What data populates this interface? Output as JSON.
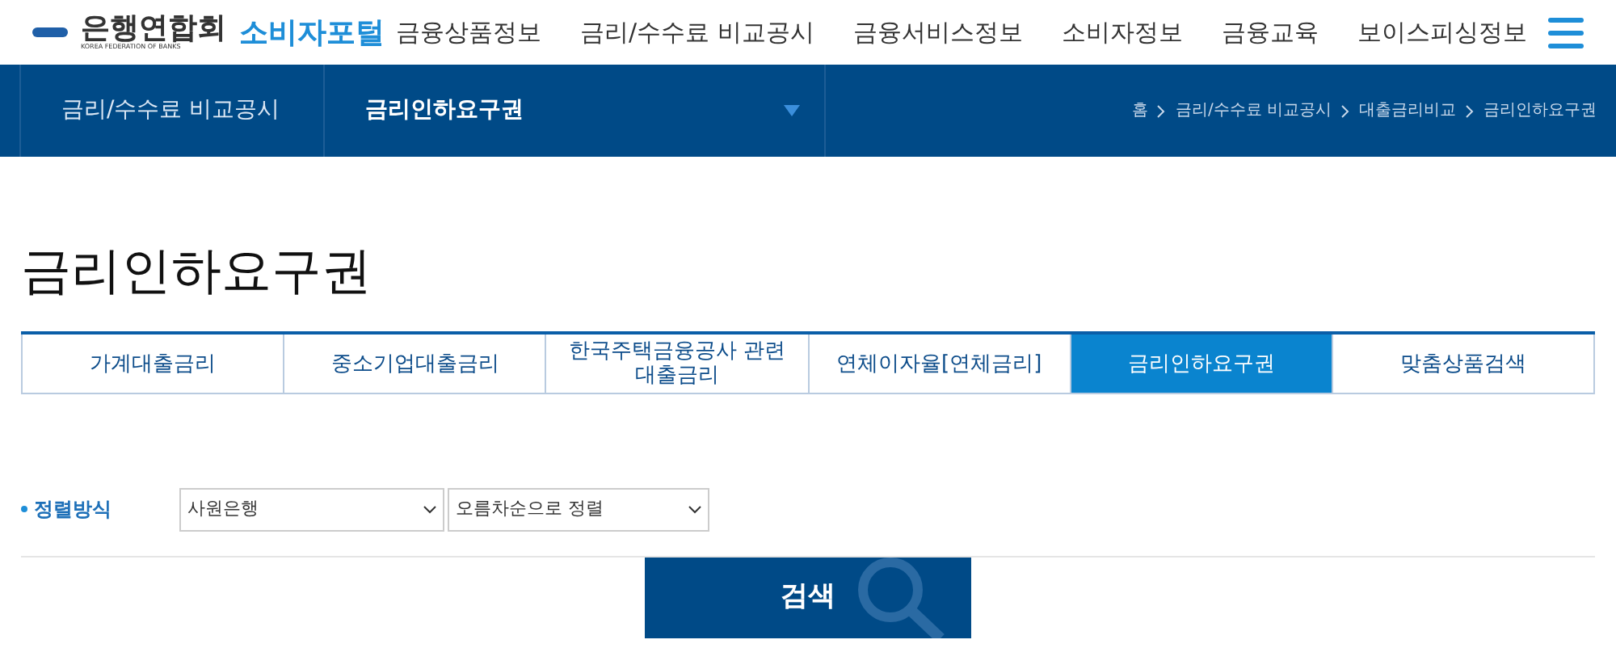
{
  "logo": {
    "name": "은행연합회",
    "subtitle": "KOREA FEDERATION OF BANKS",
    "portal": "소비자포털"
  },
  "nav": [
    "금융상품정보",
    "금리/수수료 비교공시",
    "금융서비스정보",
    "소비자정보",
    "금융교육",
    "보이스피싱정보"
  ],
  "subnav": {
    "section": "금리/수수료 비교공시",
    "current": "금리인하요구권"
  },
  "breadcrumb": [
    "홈",
    "금리/수수료 비교공시",
    "대출금리비교",
    "금리인하요구권"
  ],
  "page_title": "금리인하요구권",
  "tabs": [
    {
      "label": "가계대출금리",
      "selected": false
    },
    {
      "label": "중소기업대출금리",
      "selected": false
    },
    {
      "label": "한국주택금융공사 관련\n대출금리",
      "selected": false
    },
    {
      "label": "연체이자율[연체금리]",
      "selected": false
    },
    {
      "label": "금리인하요구권",
      "selected": true
    },
    {
      "label": "맞춤상품검색",
      "selected": false
    }
  ],
  "sort": {
    "label": "정렬방식",
    "selects": [
      "사원은행",
      "오름차순으로 정렬"
    ]
  },
  "search_button": "검색"
}
